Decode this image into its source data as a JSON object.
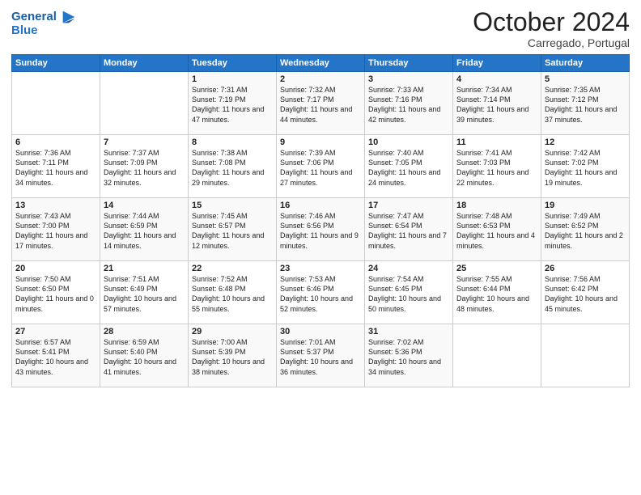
{
  "header": {
    "logo_line1": "General",
    "logo_line2": "Blue",
    "month": "October 2024",
    "location": "Carregado, Portugal"
  },
  "days_of_week": [
    "Sunday",
    "Monday",
    "Tuesday",
    "Wednesday",
    "Thursday",
    "Friday",
    "Saturday"
  ],
  "weeks": [
    [
      {
        "day": "",
        "sunrise": "",
        "sunset": "",
        "daylight": ""
      },
      {
        "day": "",
        "sunrise": "",
        "sunset": "",
        "daylight": ""
      },
      {
        "day": "1",
        "sunrise": "Sunrise: 7:31 AM",
        "sunset": "Sunset: 7:19 PM",
        "daylight": "Daylight: 11 hours and 47 minutes."
      },
      {
        "day": "2",
        "sunrise": "Sunrise: 7:32 AM",
        "sunset": "Sunset: 7:17 PM",
        "daylight": "Daylight: 11 hours and 44 minutes."
      },
      {
        "day": "3",
        "sunrise": "Sunrise: 7:33 AM",
        "sunset": "Sunset: 7:16 PM",
        "daylight": "Daylight: 11 hours and 42 minutes."
      },
      {
        "day": "4",
        "sunrise": "Sunrise: 7:34 AM",
        "sunset": "Sunset: 7:14 PM",
        "daylight": "Daylight: 11 hours and 39 minutes."
      },
      {
        "day": "5",
        "sunrise": "Sunrise: 7:35 AM",
        "sunset": "Sunset: 7:12 PM",
        "daylight": "Daylight: 11 hours and 37 minutes."
      }
    ],
    [
      {
        "day": "6",
        "sunrise": "Sunrise: 7:36 AM",
        "sunset": "Sunset: 7:11 PM",
        "daylight": "Daylight: 11 hours and 34 minutes."
      },
      {
        "day": "7",
        "sunrise": "Sunrise: 7:37 AM",
        "sunset": "Sunset: 7:09 PM",
        "daylight": "Daylight: 11 hours and 32 minutes."
      },
      {
        "day": "8",
        "sunrise": "Sunrise: 7:38 AM",
        "sunset": "Sunset: 7:08 PM",
        "daylight": "Daylight: 11 hours and 29 minutes."
      },
      {
        "day": "9",
        "sunrise": "Sunrise: 7:39 AM",
        "sunset": "Sunset: 7:06 PM",
        "daylight": "Daylight: 11 hours and 27 minutes."
      },
      {
        "day": "10",
        "sunrise": "Sunrise: 7:40 AM",
        "sunset": "Sunset: 7:05 PM",
        "daylight": "Daylight: 11 hours and 24 minutes."
      },
      {
        "day": "11",
        "sunrise": "Sunrise: 7:41 AM",
        "sunset": "Sunset: 7:03 PM",
        "daylight": "Daylight: 11 hours and 22 minutes."
      },
      {
        "day": "12",
        "sunrise": "Sunrise: 7:42 AM",
        "sunset": "Sunset: 7:02 PM",
        "daylight": "Daylight: 11 hours and 19 minutes."
      }
    ],
    [
      {
        "day": "13",
        "sunrise": "Sunrise: 7:43 AM",
        "sunset": "Sunset: 7:00 PM",
        "daylight": "Daylight: 11 hours and 17 minutes."
      },
      {
        "day": "14",
        "sunrise": "Sunrise: 7:44 AM",
        "sunset": "Sunset: 6:59 PM",
        "daylight": "Daylight: 11 hours and 14 minutes."
      },
      {
        "day": "15",
        "sunrise": "Sunrise: 7:45 AM",
        "sunset": "Sunset: 6:57 PM",
        "daylight": "Daylight: 11 hours and 12 minutes."
      },
      {
        "day": "16",
        "sunrise": "Sunrise: 7:46 AM",
        "sunset": "Sunset: 6:56 PM",
        "daylight": "Daylight: 11 hours and 9 minutes."
      },
      {
        "day": "17",
        "sunrise": "Sunrise: 7:47 AM",
        "sunset": "Sunset: 6:54 PM",
        "daylight": "Daylight: 11 hours and 7 minutes."
      },
      {
        "day": "18",
        "sunrise": "Sunrise: 7:48 AM",
        "sunset": "Sunset: 6:53 PM",
        "daylight": "Daylight: 11 hours and 4 minutes."
      },
      {
        "day": "19",
        "sunrise": "Sunrise: 7:49 AM",
        "sunset": "Sunset: 6:52 PM",
        "daylight": "Daylight: 11 hours and 2 minutes."
      }
    ],
    [
      {
        "day": "20",
        "sunrise": "Sunrise: 7:50 AM",
        "sunset": "Sunset: 6:50 PM",
        "daylight": "Daylight: 11 hours and 0 minutes."
      },
      {
        "day": "21",
        "sunrise": "Sunrise: 7:51 AM",
        "sunset": "Sunset: 6:49 PM",
        "daylight": "Daylight: 10 hours and 57 minutes."
      },
      {
        "day": "22",
        "sunrise": "Sunrise: 7:52 AM",
        "sunset": "Sunset: 6:48 PM",
        "daylight": "Daylight: 10 hours and 55 minutes."
      },
      {
        "day": "23",
        "sunrise": "Sunrise: 7:53 AM",
        "sunset": "Sunset: 6:46 PM",
        "daylight": "Daylight: 10 hours and 52 minutes."
      },
      {
        "day": "24",
        "sunrise": "Sunrise: 7:54 AM",
        "sunset": "Sunset: 6:45 PM",
        "daylight": "Daylight: 10 hours and 50 minutes."
      },
      {
        "day": "25",
        "sunrise": "Sunrise: 7:55 AM",
        "sunset": "Sunset: 6:44 PM",
        "daylight": "Daylight: 10 hours and 48 minutes."
      },
      {
        "day": "26",
        "sunrise": "Sunrise: 7:56 AM",
        "sunset": "Sunset: 6:42 PM",
        "daylight": "Daylight: 10 hours and 45 minutes."
      }
    ],
    [
      {
        "day": "27",
        "sunrise": "Sunrise: 6:57 AM",
        "sunset": "Sunset: 5:41 PM",
        "daylight": "Daylight: 10 hours and 43 minutes."
      },
      {
        "day": "28",
        "sunrise": "Sunrise: 6:59 AM",
        "sunset": "Sunset: 5:40 PM",
        "daylight": "Daylight: 10 hours and 41 minutes."
      },
      {
        "day": "29",
        "sunrise": "Sunrise: 7:00 AM",
        "sunset": "Sunset: 5:39 PM",
        "daylight": "Daylight: 10 hours and 38 minutes."
      },
      {
        "day": "30",
        "sunrise": "Sunrise: 7:01 AM",
        "sunset": "Sunset: 5:37 PM",
        "daylight": "Daylight: 10 hours and 36 minutes."
      },
      {
        "day": "31",
        "sunrise": "Sunrise: 7:02 AM",
        "sunset": "Sunset: 5:36 PM",
        "daylight": "Daylight: 10 hours and 34 minutes."
      },
      {
        "day": "",
        "sunrise": "",
        "sunset": "",
        "daylight": ""
      },
      {
        "day": "",
        "sunrise": "",
        "sunset": "",
        "daylight": ""
      }
    ]
  ]
}
